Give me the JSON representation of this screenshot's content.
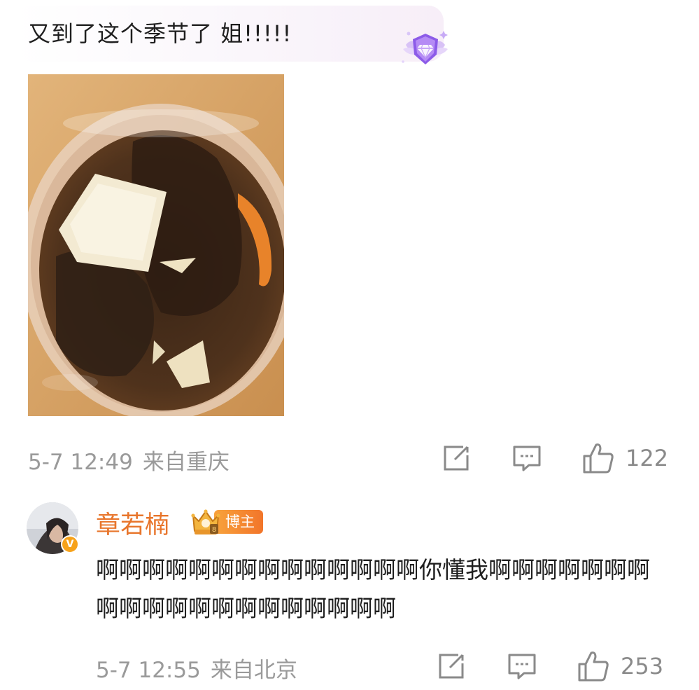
{
  "comments": [
    {
      "text": "又到了这个季节了 姐!!!!!",
      "time": "5-7 12:49",
      "location": "来自重庆",
      "likes": "122",
      "badge_icon": "diamond-fan-badge",
      "has_photo": true
    },
    {
      "username": "章若楠",
      "author_tag": "博主",
      "verified_icon": "v-verified",
      "text": "啊啊啊啊啊啊啊啊啊啊啊啊啊啊你懂我啊啊啊啊啊啊啊啊啊啊啊啊啊啊啊啊啊啊啊啊",
      "time": "5-7 12:55",
      "location": "来自北京",
      "likes": "253"
    }
  ],
  "icons": {
    "share": "share-icon",
    "comment": "comment-icon",
    "like": "thumbs-up-icon"
  },
  "colors": {
    "username": "#e8752b",
    "meta": "#9a9a9a",
    "icon": "#8a8a8a",
    "badge_purple": "#a77df0"
  }
}
